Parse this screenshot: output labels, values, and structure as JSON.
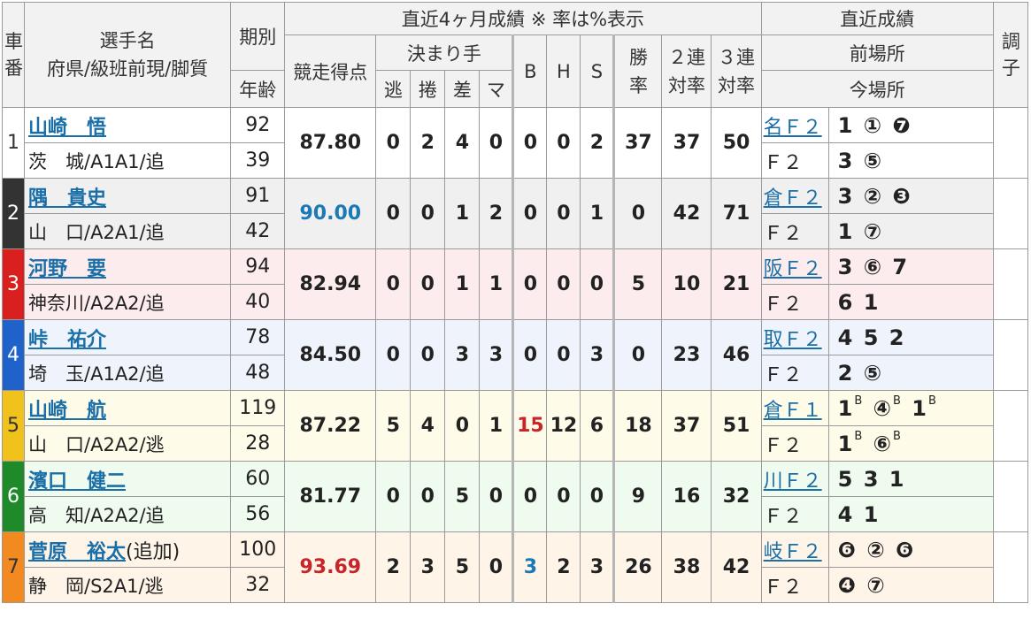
{
  "header": {
    "car_no": "車番",
    "name_line1": "選手名",
    "name_line2": "府県/級班前現/脚質",
    "period": "期別",
    "age": "年齢",
    "recent4": "直近4ヶ月成績 ※ 率は%表示",
    "score": "競走得点",
    "kimarite": "決まり手",
    "nige": "逃",
    "makuri": "捲",
    "sashi": "差",
    "ma": "マ",
    "b": "B",
    "h": "H",
    "s": "S",
    "win_rate": "勝率",
    "ren2": "２連対率",
    "ren3": "３連対率",
    "recent_results": "直近成績",
    "prev_venue": "前場所",
    "this_venue": "今場所",
    "condition": "調子"
  },
  "colors": {
    "row_bg": [
      "#ffffff",
      "#f0f0f0",
      "#fdeced",
      "#eef3fc",
      "#fffbe9",
      "#eefbee",
      "#fff4e8"
    ],
    "car_bg": [
      "#ffffff",
      "#333333",
      "#d9201f",
      "#1f62c9",
      "#f2c21c",
      "#1f8a2a",
      "#f28a1f"
    ],
    "car_text": [
      "#333333",
      "#ffffff",
      "#ffffff",
      "#ffffff",
      "#333333",
      "#ffffff",
      "#333333"
    ]
  },
  "racers": [
    {
      "car": "1",
      "name": "山崎　悟",
      "extra": "",
      "pref": "茨　城/A1A1/追",
      "period": "92",
      "age": "39",
      "score": "87.80",
      "nige": "0",
      "makuri": "2",
      "sashi": "4",
      "ma": "0",
      "b": "0",
      "h": "0",
      "s": "2",
      "win": "37",
      "ren2": "37",
      "ren3": "50",
      "prev": "名Ｆ２",
      "cur": "Ｆ２",
      "prev_res": [
        "1",
        "①",
        "❼"
      ],
      "cur_res": [
        "3",
        "⑤"
      ]
    },
    {
      "car": "2",
      "name": "隅　貴史",
      "extra": "",
      "pref": "山　口/A2A1/追",
      "period": "91",
      "age": "42",
      "score": "90.00",
      "nige": "0",
      "makuri": "0",
      "sashi": "1",
      "ma": "2",
      "b": "0",
      "h": "0",
      "s": "1",
      "win": "0",
      "ren2": "42",
      "ren3": "71",
      "prev": "倉Ｆ２",
      "cur": "Ｆ２",
      "prev_res": [
        "3",
        "②",
        "❸"
      ],
      "cur_res": [
        "1",
        "⑦"
      ]
    },
    {
      "car": "3",
      "name": "河野　要",
      "extra": "",
      "pref": "神奈川/A2A2/追",
      "period": "94",
      "age": "40",
      "score": "82.94",
      "nige": "0",
      "makuri": "0",
      "sashi": "1",
      "ma": "1",
      "b": "0",
      "h": "0",
      "s": "0",
      "win": "5",
      "ren2": "10",
      "ren3": "21",
      "prev": "阪Ｆ２",
      "cur": "Ｆ２",
      "prev_res": [
        "3",
        "⑥",
        "7"
      ],
      "cur_res": [
        "6",
        "1"
      ]
    },
    {
      "car": "4",
      "name": "峠　祐介",
      "extra": "",
      "pref": "埼　玉/A1A2/追",
      "period": "78",
      "age": "48",
      "score": "84.50",
      "nige": "0",
      "makuri": "0",
      "sashi": "3",
      "ma": "3",
      "b": "0",
      "h": "0",
      "s": "3",
      "win": "0",
      "ren2": "23",
      "ren3": "46",
      "prev": "取Ｆ２",
      "cur": "Ｆ２",
      "prev_res": [
        "4",
        "5",
        "2"
      ],
      "cur_res": [
        "2",
        "⑤"
      ]
    },
    {
      "car": "5",
      "name": "山崎　航",
      "extra": "",
      "pref": "山　口/A2A2/逃",
      "period": "119",
      "age": "28",
      "score": "87.22",
      "nige": "5",
      "makuri": "4",
      "sashi": "0",
      "ma": "1",
      "b": "15",
      "h": "12",
      "s": "6",
      "win": "18",
      "ren2": "37",
      "ren3": "51",
      "prev": "倉Ｆ１",
      "cur": "Ｆ２",
      "prev_res": [
        "1",
        "④",
        "1"
      ],
      "cur_res": [
        "1",
        "⑥"
      ],
      "sup": "B"
    },
    {
      "car": "6",
      "name": "濱口　健二",
      "extra": "",
      "pref": "高　知/A2A2/追",
      "period": "60",
      "age": "56",
      "score": "81.77",
      "nige": "0",
      "makuri": "0",
      "sashi": "5",
      "ma": "0",
      "b": "0",
      "h": "0",
      "s": "0",
      "win": "9",
      "ren2": "16",
      "ren3": "32",
      "prev": "川Ｆ２",
      "cur": "Ｆ２",
      "prev_res": [
        "5",
        "3",
        "1"
      ],
      "cur_res": [
        "4",
        "1"
      ]
    },
    {
      "car": "7",
      "name": "菅原　裕太",
      "extra": "(追加)",
      "pref": "静　岡/S2A1/逃",
      "period": "100",
      "age": "32",
      "score": "93.69",
      "nige": "2",
      "makuri": "3",
      "sashi": "5",
      "ma": "0",
      "b": "3",
      "h": "2",
      "s": "3",
      "win": "26",
      "ren2": "38",
      "ren3": "42",
      "prev": "岐Ｆ２",
      "cur": "Ｆ２",
      "prev_res": [
        "❻",
        "②",
        "❻"
      ],
      "cur_res": [
        "❹",
        "⑦"
      ]
    }
  ]
}
